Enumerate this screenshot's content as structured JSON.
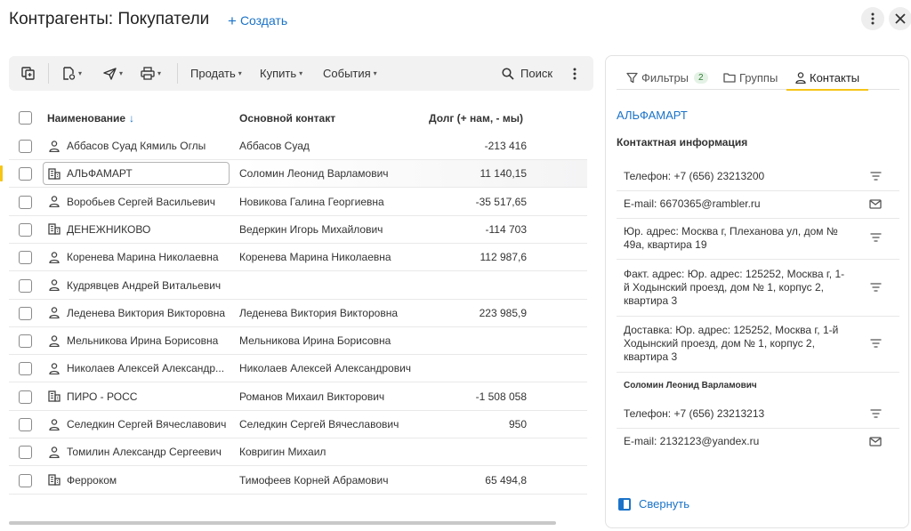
{
  "header": {
    "title": "Контрагенты: Покупатели",
    "create_label": "Создать",
    "more_icon": "more-vertical-icon",
    "close_icon": "close-icon"
  },
  "toolbar": {
    "sell_label": "Продать",
    "buy_label": "Купить",
    "events_label": "События",
    "search_label": "Поиск"
  },
  "table": {
    "columns": {
      "name": "Наименование",
      "contact": "Основной контакт",
      "debt": "Долг (+ нам, - мы)"
    },
    "sort_indicator": "↓",
    "rows": [
      {
        "type": "person",
        "name": "Аббасов Суад Кямиль Оглы",
        "contact": "Аббасов Суад",
        "debt": "-213 416"
      },
      {
        "type": "company",
        "name": "АЛЬФАМАРТ",
        "contact": "Соломин Леонид Варламович",
        "debt": "11 140,15",
        "selected": true
      },
      {
        "type": "person",
        "name": "Воробьев Сергей Васильевич",
        "contact": "Новикова Галина Георгиевна",
        "debt": "-35 517,65"
      },
      {
        "type": "company",
        "name": "ДЕНЕЖНИКОВО",
        "contact": "Ведеркин Игорь Михайлович",
        "debt": "-114 703"
      },
      {
        "type": "person",
        "name": "Коренева Марина Николаевна",
        "contact": "Коренева Марина Николаевна",
        "debt": "112 987,6"
      },
      {
        "type": "person",
        "name": "Кудрявцев Андрей Витальевич",
        "contact": "",
        "debt": ""
      },
      {
        "type": "person",
        "name": "Леденева Виктория Викторовна",
        "contact": "Леденева Виктория Викторовна",
        "debt": "223 985,9"
      },
      {
        "type": "person",
        "name": "Мельникова Ирина Борисовна",
        "contact": "Мельникова Ирина Борисовна",
        "debt": ""
      },
      {
        "type": "person",
        "name": "Николаев Алексей Александр...",
        "contact": "Николаев Алексей Александрович",
        "debt": ""
      },
      {
        "type": "company",
        "name": "ПИРО - РОСС",
        "contact": "Романов Михаил Викторович",
        "debt": "-1 508 058"
      },
      {
        "type": "person",
        "name": "Селедкин Сергей Вячеславович",
        "contact": "Селедкин Сергей Вячеславович",
        "debt": "950"
      },
      {
        "type": "person",
        "name": "Томилин Александр Сергеевич",
        "contact": "Ковригин Михаил",
        "debt": ""
      },
      {
        "type": "company",
        "name": "Ферроком",
        "contact": "Тимофеев Корней Абрамович",
        "debt": "65 494,8"
      }
    ]
  },
  "panel": {
    "tabs": {
      "filters": "Фильтры",
      "filters_count": "2",
      "groups": "Группы",
      "contacts": "Контакты"
    },
    "company_name": "АЛЬФАМАРТ",
    "section_title": "Контактная информация",
    "company_info": [
      {
        "text": "Телефон: +7 (656) 23213200",
        "action_icon": "menu-lines-icon"
      },
      {
        "text": "E-mail: 6670365@rambler.ru",
        "action_icon": "mail-icon"
      },
      {
        "text": "Юр. адрес: Москва г, Плеханова ул, дом № 49а, квартира 19",
        "action_icon": "menu-lines-icon"
      },
      {
        "text": "Факт. адрес: Юр. адрес: 125252, Москва г, 1-й Ходынский проезд, дом № 1, корпус 2, квартира 3",
        "action_icon": "menu-lines-icon"
      },
      {
        "text": "Доставка: Юр. адрес: 125252, Москва г, 1-й Ходынский проезд, дом № 1, корпус 2, квартира 3",
        "action_icon": "menu-lines-icon"
      }
    ],
    "person_name": "Соломин Леонид Варламович",
    "person_info": [
      {
        "text": "Телефон: +7 (656) 23213213",
        "action_icon": "menu-lines-icon"
      },
      {
        "text": "E-mail: 2132123@yandex.ru",
        "action_icon": "mail-icon"
      }
    ],
    "collapse_label": "Свернуть"
  }
}
